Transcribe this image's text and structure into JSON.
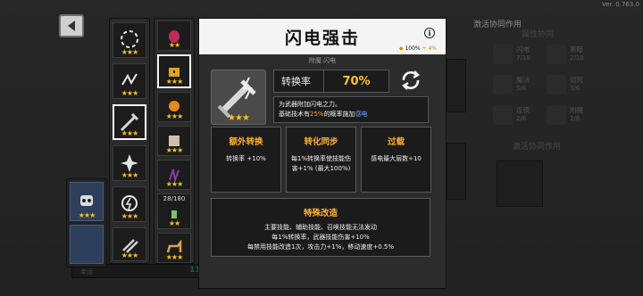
{
  "version": "Ver. 0.763.0",
  "panel": {
    "title": "闪电强击",
    "head_stat_pct": "100%",
    "head_stat_bonus": "+ 4%",
    "subtitle": "附魔 闪电",
    "rate_label": "转换率",
    "rate_value": "70%",
    "desc_line1": "为武器附加闪电之力。",
    "desc_line2_pre": "基础技术有",
    "desc_line2_pct": "25%",
    "desc_line2_mid": "的概率施加",
    "desc_line2_effect": "感电",
    "cards": [
      {
        "title": "额外转换",
        "text": "转换率 +10%"
      },
      {
        "title": "转化同步",
        "text": "每1%转换率使技能伤害+1% (最大100%)"
      },
      {
        "title": "过载",
        "text": "感电最大层数+10"
      }
    ],
    "special_title": "特殊改造",
    "special_lines": [
      "主要技能、辅助技能、召唤技能无法发动",
      "每1%转换率，武器技能伤害+10%",
      "每禁用技能改造1次，攻击力+1%，移动速度+0.5%"
    ]
  },
  "right": {
    "active_synergy_header": "激活协同作用",
    "attr_header": "属性协同",
    "active_synergy_header2": "激活协同作用",
    "attrs": [
      {
        "name": "闪电",
        "val": "7/10"
      },
      {
        "name": "黑暗",
        "val": "2/10"
      },
      {
        "name": "魔法",
        "val": "5/6"
      },
      {
        "name": "诅咒",
        "val": "3/6"
      },
      {
        "name": "连锁",
        "val": "2/6"
      },
      {
        "name": "附魔",
        "val": "2/6"
      }
    ]
  },
  "slot_count": "28/180",
  "bottom": {
    "pct": "110%",
    "label": "幸运"
  },
  "stars": {
    "three": "★★★",
    "two": "★★",
    "four": "★★★★"
  },
  "colors": {
    "gold": "#f6c21c",
    "orange": "#ffb12a",
    "blue": "#76a4ff"
  }
}
